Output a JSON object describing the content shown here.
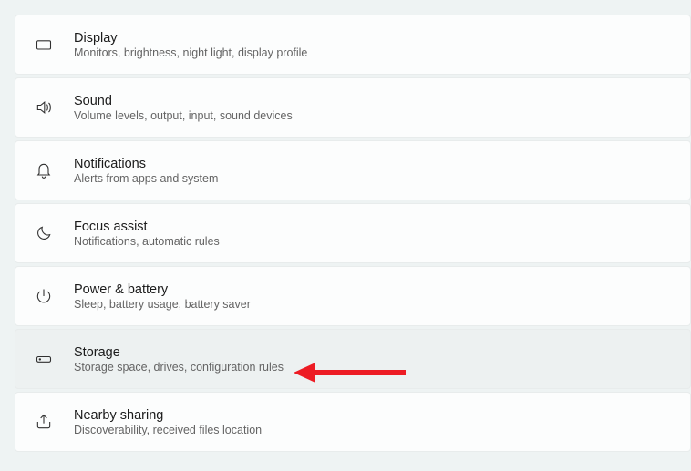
{
  "settings": {
    "items": [
      {
        "title": "Display",
        "subtitle": "Monitors, brightness, night light, display profile"
      },
      {
        "title": "Sound",
        "subtitle": "Volume levels, output, input, sound devices"
      },
      {
        "title": "Notifications",
        "subtitle": "Alerts from apps and system"
      },
      {
        "title": "Focus assist",
        "subtitle": "Notifications, automatic rules"
      },
      {
        "title": "Power & battery",
        "subtitle": "Sleep, battery usage, battery saver"
      },
      {
        "title": "Storage",
        "subtitle": "Storage space, drives, configuration rules"
      },
      {
        "title": "Nearby sharing",
        "subtitle": "Discoverability, received files location"
      }
    ]
  }
}
